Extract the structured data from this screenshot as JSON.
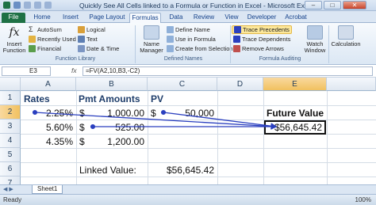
{
  "title_bar": {
    "app_title": "Quickly See All Cells linked to a Formula or Function in Excel - Microsoft Excel",
    "minimize": "–",
    "maximize": "□",
    "close": "✕"
  },
  "ribbon_tabs": [
    "File",
    "Home",
    "Insert",
    "Page Layout",
    "Formulas",
    "Data",
    "Review",
    "View",
    "Developer",
    "Acrobat"
  ],
  "active_tab": "Formulas",
  "ribbon": {
    "insert_function": "Insert Function",
    "autosum": "AutoSum",
    "recently_used": "Recently Used",
    "financial": "Financial",
    "logical": "Logical",
    "text": "Text",
    "date_time": "Date & Time",
    "group_function_library": "Function Library",
    "name_manager": "Name Manager",
    "define_name": "Define Name",
    "use_in_formula": "Use in Formula",
    "create_from_selection": "Create from Selection",
    "group_defined_names": "Defined Names",
    "trace_precedents": "Trace Precedents",
    "trace_dependents": "Trace Dependents",
    "remove_arrows": "Remove Arrows",
    "group_formula_auditing": "Formula Auditing",
    "watch_window": "Watch Window",
    "calculation": "Calculation"
  },
  "formula_bar": {
    "name_box": "E3",
    "fx": "fx",
    "formula": "=FV(A2,10,B3,-C2)"
  },
  "columns": [
    "A",
    "B",
    "C",
    "D",
    "E"
  ],
  "rows": [
    "1",
    "2",
    "3",
    "4",
    "5",
    "6",
    "7"
  ],
  "selected_cell": "E3",
  "cells": {
    "A2": "Rates",
    "B2": "Pmt Amounts",
    "C2": "PV",
    "A3": "2.25%",
    "B3_sym": "$",
    "B3": "1,000.00",
    "C3_sym": "$",
    "C3": "50,000",
    "E3": "Future Value",
    "A4": "5.60%",
    "B4_sym": "$",
    "B4": "525.00",
    "E4": "$56,645.42",
    "A5": "4.35%",
    "B5_sym": "$",
    "B5": "1,200.00",
    "B7": "Linked Value:",
    "C7": "$56,645.42"
  },
  "sheet_tab": "Sheet1",
  "status": {
    "mode": "Ready",
    "zoom": "100%"
  },
  "colors": {
    "file_tab": "#1e7145",
    "trace_arrow": "#2a3fbf",
    "selection_header": "#f1c15f"
  }
}
